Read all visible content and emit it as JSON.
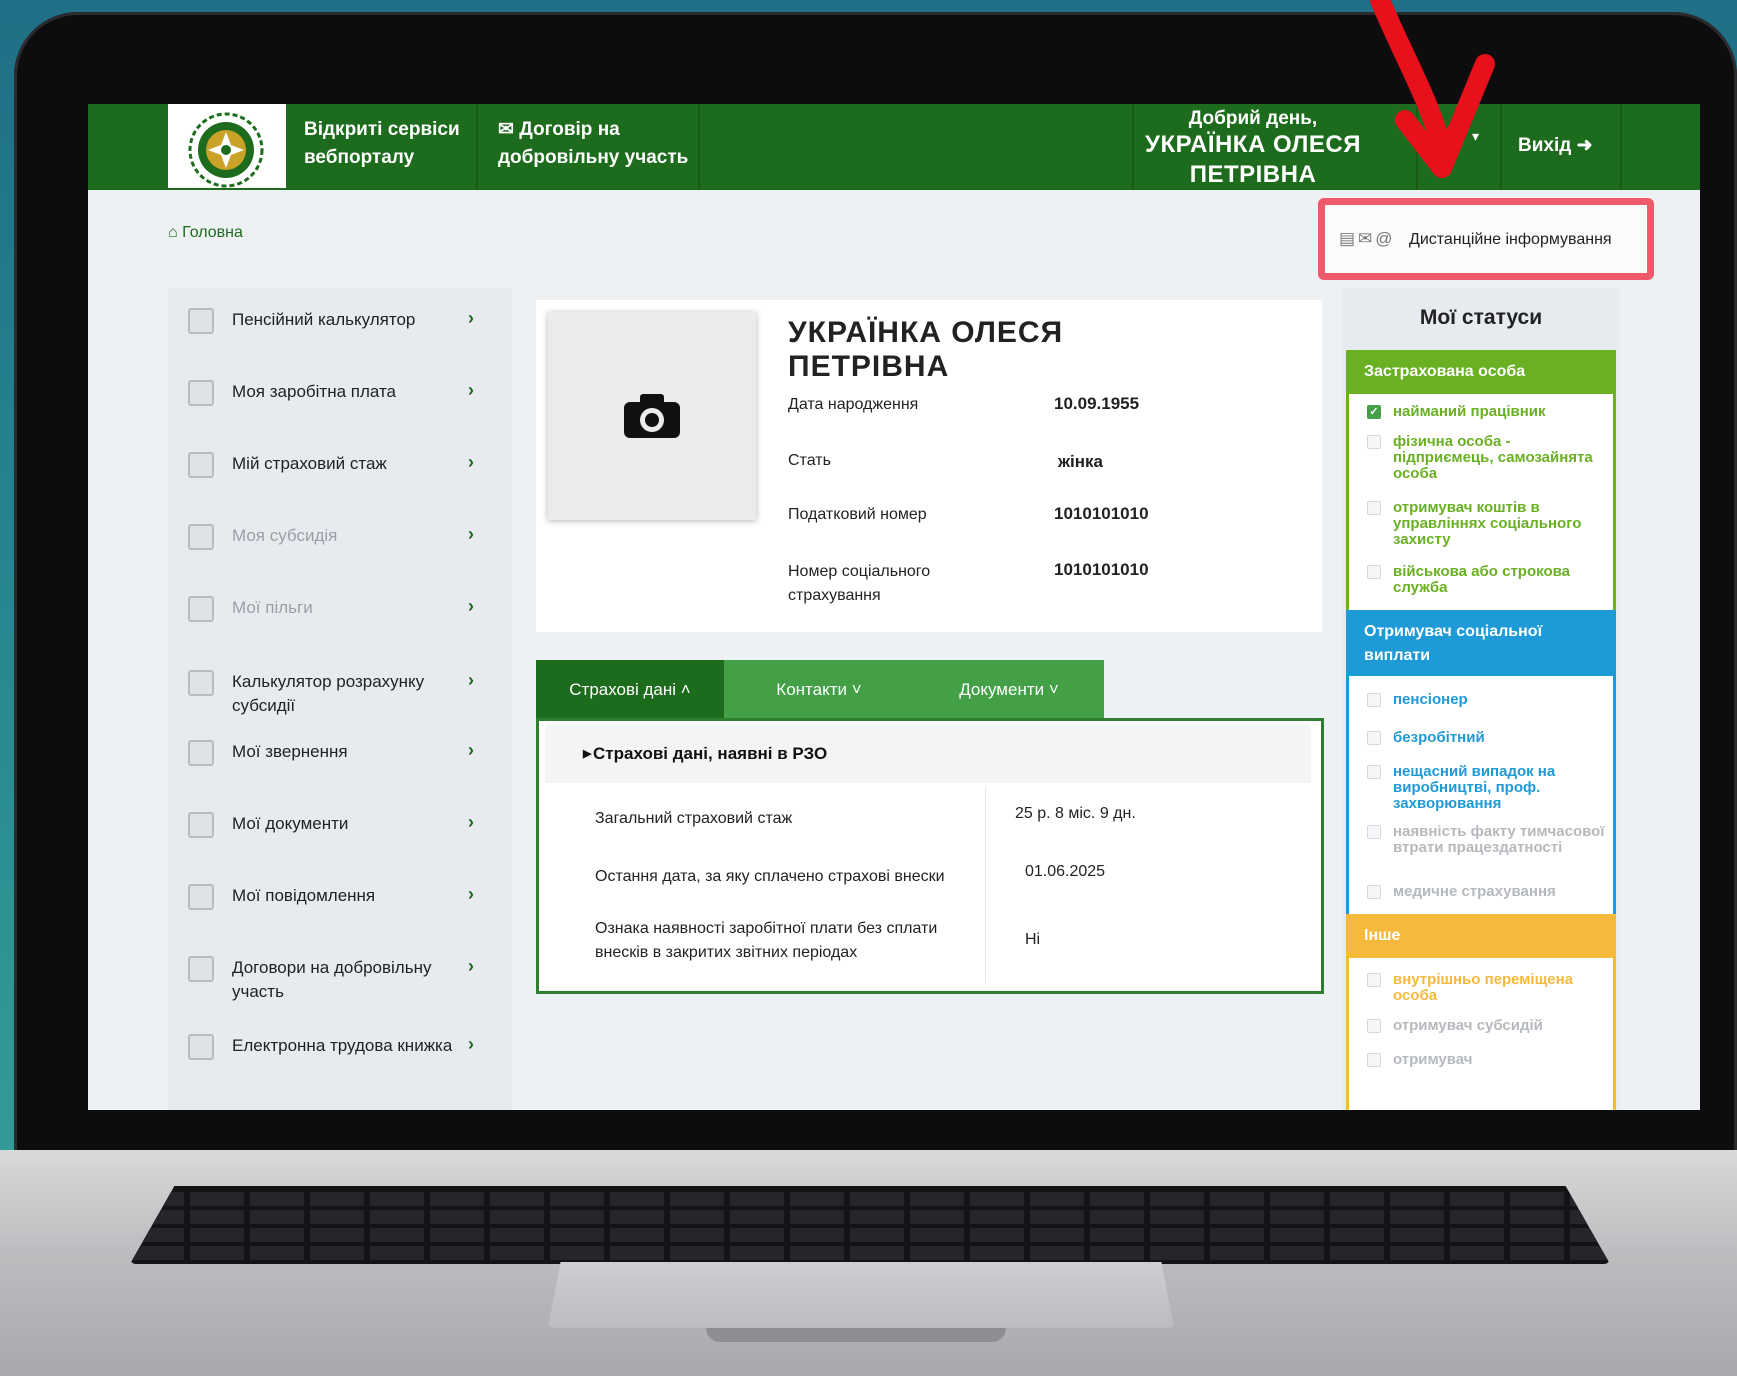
{
  "header": {
    "open_services": "Відкриті сервіси вебпорталу",
    "contract": "Договір на добровільну участь",
    "greeting": "Добрий день,",
    "user_name": "УКРАЇНКА ОЛЕСЯ ПЕТРІВНА",
    "logout": "Вихід"
  },
  "breadcrumb": {
    "home": "Головна"
  },
  "remote_info": {
    "label": "Дистанційне інформування"
  },
  "sidebar": {
    "items": [
      {
        "label": "Пенсійний калькулятор",
        "dim": false
      },
      {
        "label": "Моя заробітна плата",
        "dim": false
      },
      {
        "label": "Мій страховий стаж",
        "dim": false
      },
      {
        "label": "Моя субсидія",
        "dim": true
      },
      {
        "label": "Мої пільги",
        "dim": true
      },
      {
        "label": "Калькулятор розрахунку субсидії",
        "dim": false
      },
      {
        "label": "Мої звернення",
        "dim": false
      },
      {
        "label": "Мої документи",
        "dim": false
      },
      {
        "label": "Мої повідомлення",
        "dim": false
      },
      {
        "label": "Договори на добровільну участь",
        "dim": false
      },
      {
        "label": "Електронна трудова книжка",
        "dim": false
      }
    ]
  },
  "profile": {
    "name": "УКРАЇНКА ОЛЕСЯ ПЕТРІВНА",
    "rows": [
      {
        "label": "Дата народження",
        "value": "10.09.1955"
      },
      {
        "label": "Стать",
        "value": "жінка"
      },
      {
        "label": "Податковий номер",
        "value": "1010101010"
      },
      {
        "label": "Номер соціального страхування",
        "value": "1010101010"
      }
    ]
  },
  "tabs": [
    {
      "label": "Страхові дані"
    },
    {
      "label": "Контакти"
    },
    {
      "label": "Документи"
    }
  ],
  "insurance": {
    "heading": "Страхові дані, наявні в РЗО",
    "rows": [
      {
        "label": "Загальний страховий стаж",
        "value": "25 р. 8 міс. 9 дн."
      },
      {
        "label": "Остання дата, за яку сплачено страхові внески",
        "value": "01.06.2025"
      },
      {
        "label": "Ознака наявності заробітної плати без сплати внесків в закритих звітних періодах",
        "value": "Ні"
      }
    ]
  },
  "statuses": {
    "title": "Мої статуси",
    "groups": [
      {
        "heading": "Застрахована особа",
        "color": "#6ab023",
        "items": [
          {
            "label": "найманий працівник",
            "checked": true
          },
          {
            "label": "фізична особа - підприємець, самозайнята особа",
            "checked": false
          },
          {
            "label": "отримувач коштів в управліннях соціального захисту",
            "checked": false
          },
          {
            "label": "військова або строкова служба",
            "checked": false
          }
        ]
      },
      {
        "heading": "Отримувач соціальної виплати",
        "color": "#1e9ad6",
        "items": [
          {
            "label": "пенсіонер",
            "checked": false
          },
          {
            "label": "безробітний",
            "checked": false
          },
          {
            "label": "нещасний випадок на виробництві, проф. захворювання",
            "checked": false
          },
          {
            "label": "наявність факту тимчасової втрати працездатності",
            "checked": false
          },
          {
            "label": "медичне страхування",
            "checked": false
          }
        ]
      },
      {
        "heading": "Інше",
        "color": "#f6b93b",
        "items": [
          {
            "label": "внутрішньо переміщена особа",
            "checked": false
          },
          {
            "label": "отримувач субсидій",
            "checked": false
          },
          {
            "label": "отримувач",
            "checked": false
          }
        ]
      }
    ]
  },
  "colors": {
    "brand_green": "#1d6b1c",
    "tab_green": "#43a047",
    "highlight_red": "#ef5a6a",
    "arrow_red": "#e8101a"
  }
}
